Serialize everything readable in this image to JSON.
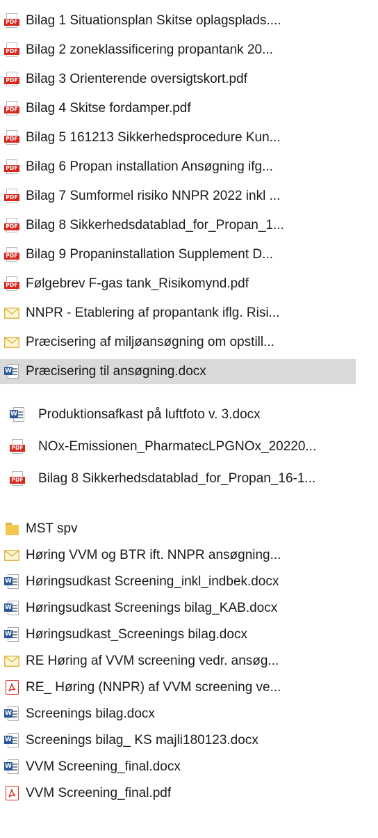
{
  "files": [
    {
      "name": "Bilag 1 Situationsplan Skitse oplagsplads....",
      "icon": "pdf-icon"
    },
    {
      "name": "Bilag 2 zoneklassificering propantank 20...",
      "icon": "pdf-icon"
    },
    {
      "name": "Bilag 3 Orienterende oversigtskort.pdf",
      "icon": "pdf-icon"
    },
    {
      "name": "Bilag 4 Skitse fordamper.pdf",
      "icon": "pdf-icon"
    },
    {
      "name": "Bilag 5 161213 Sikkerhedsprocedure Kun...",
      "icon": "pdf-icon"
    },
    {
      "name": "Bilag 6 Propan installation Ansøgning ifg...",
      "icon": "pdf-icon"
    },
    {
      "name": "Bilag 7 Sumformel risiko NNPR 2022 inkl ...",
      "icon": "pdf-icon"
    },
    {
      "name": "Bilag 8 Sikkerhedsdatablad_for_Propan_1...",
      "icon": "pdf-icon"
    },
    {
      "name": "Bilag 9 Propaninstallation Supplement D...",
      "icon": "pdf-icon"
    },
    {
      "name": "Følgebrev F-gas tank_Risikomynd.pdf",
      "icon": "pdf-icon"
    },
    {
      "name": "NNPR - Etablering af propantank iflg. Risi...",
      "icon": "mail-icon"
    },
    {
      "name": "Præcisering af miljøansøgning om opstill...",
      "icon": "mail-icon"
    },
    {
      "name": "Præcisering til ansøgning.docx",
      "icon": "word-icon",
      "selected": true
    },
    {
      "name": "Produktionsafkast på luftfoto v. 3.docx",
      "icon": "word-icon"
    },
    {
      "name": "NOx-Emissionen_PharmatecLPGNOx_20220...",
      "icon": "pdf-icon"
    },
    {
      "name": "Bilag 8 Sikkerhedsdatablad_for_Propan_16-1...",
      "icon": "pdf-icon"
    },
    {
      "name": "MST spv",
      "icon": "folder-icon"
    },
    {
      "name": "Høring VVM og BTR ift. NNPR ansøgning...",
      "icon": "mail-icon"
    },
    {
      "name": "Høringsudkast Screening_inkl_indbek.docx",
      "icon": "word-icon"
    },
    {
      "name": "Høringsudkast Screenings bilag_KAB.docx",
      "icon": "word-icon"
    },
    {
      "name": "Høringsudkast_Screenings bilag.docx",
      "icon": "word-icon"
    },
    {
      "name": "RE Høring af VVM screening vedr. ansøg...",
      "icon": "mail-icon"
    },
    {
      "name": "RE_ Høring (NNPR) af VVM screening ve...",
      "icon": "acrobat-pdf-icon"
    },
    {
      "name": "Screenings bilag.docx",
      "icon": "word-icon"
    },
    {
      "name": "Screenings bilag_ KS majli180123.docx",
      "icon": "word-icon"
    },
    {
      "name": "VVM Screening_final.docx",
      "icon": "word-icon"
    },
    {
      "name": "VVM Screening_final.pdf",
      "icon": "acrobat-pdf-icon"
    }
  ],
  "pdf_badge_text": "PDF",
  "word_badge_text": "W",
  "colors": {
    "selection": "#d9d9d9",
    "pdf_red": "#d7261d",
    "word_blue": "#2b5797",
    "folder": "#f3c64f"
  }
}
